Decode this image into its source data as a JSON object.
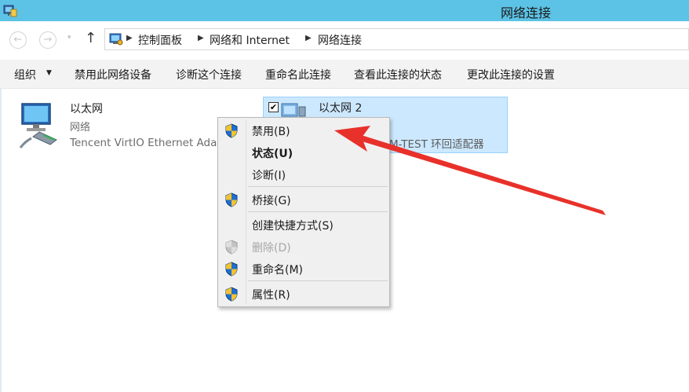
{
  "window": {
    "title": "网络连接"
  },
  "nav": {
    "back": "←",
    "forward": "→",
    "history": "▾",
    "up": "↑"
  },
  "address": {
    "breadcrumbs": [
      "控制面板",
      "网络和 Internet",
      "网络连接"
    ],
    "separator": "▶"
  },
  "toolbar": {
    "organize": "组织",
    "organize_arrow": "▼",
    "items": [
      "禁用此网络设备",
      "诊断这个连接",
      "重命名此连接",
      "查看此连接的状态",
      "更改此连接的设置"
    ]
  },
  "adapters": [
    {
      "name": "以太网",
      "status": "网络",
      "description": "Tencent VirtIO Ethernet Adapter",
      "selected": false
    },
    {
      "name": "以太网 2",
      "status": "",
      "description": "M-TEST 环回适配器",
      "selected": true,
      "checked": "✔"
    }
  ],
  "context_menu": {
    "items": [
      {
        "label": "禁用(B)",
        "icon": "uac-shield-icon",
        "bold": false,
        "disabled": false
      },
      {
        "label": "状态(U)",
        "icon": "",
        "bold": true,
        "disabled": false
      },
      {
        "label": "诊断(I)",
        "icon": "",
        "bold": false,
        "disabled": false
      },
      {
        "label": "桥接(G)",
        "icon": "uac-shield-icon",
        "bold": false,
        "disabled": false
      },
      {
        "label": "创建快捷方式(S)",
        "icon": "",
        "bold": false,
        "disabled": false
      },
      {
        "label": "删除(D)",
        "icon": "uac-shield-icon",
        "bold": false,
        "disabled": true
      },
      {
        "label": "重命名(M)",
        "icon": "uac-shield-icon",
        "bold": false,
        "disabled": false
      },
      {
        "label": "属性(R)",
        "icon": "uac-shield-icon",
        "bold": false,
        "disabled": false
      }
    ]
  },
  "colors": {
    "titlebar": "#5cc3e6",
    "selection_bg": "#cce8ff",
    "arrow": "#e8312a"
  }
}
